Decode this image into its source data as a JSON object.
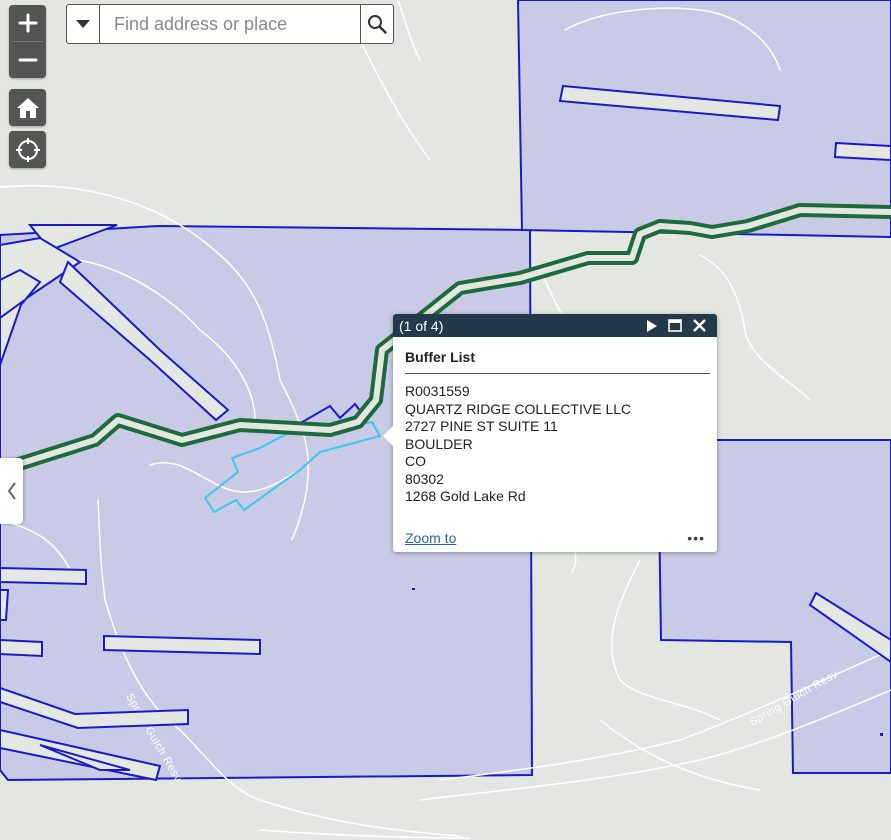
{
  "search": {
    "placeholder": "Find address or place",
    "value": ""
  },
  "map": {
    "road_labels": [
      "Spring Gulch Resv",
      "Spring Gulch Resv"
    ],
    "colors": {
      "background": "#e3e6e1",
      "parcel_fill": "#c8cae6",
      "parcel_outline": "#1a1ac8",
      "buffer_line": "#1d6b3d",
      "selected_outline": "#3ec8f0",
      "road": "#ffffff"
    }
  },
  "popup": {
    "count": "(1 of 4)",
    "title": "Buffer List",
    "fields": [
      "R0031559",
      "QUARTZ RIDGE COLLECTIVE LLC",
      "2727 PINE ST SUITE 11",
      "BOULDER",
      "CO",
      "80302",
      "1268 Gold Lake Rd"
    ],
    "zoom_label": "Zoom to",
    "more_label": "•••"
  },
  "icons": {
    "zoom_in": "plus-icon",
    "zoom_out": "minus-icon",
    "home": "home-icon",
    "locate": "locate-icon",
    "dropdown": "caret-down-icon",
    "search": "search-icon",
    "collapse": "chevron-left-icon",
    "next": "play-icon",
    "maximize": "maximize-icon",
    "close": "close-icon"
  }
}
